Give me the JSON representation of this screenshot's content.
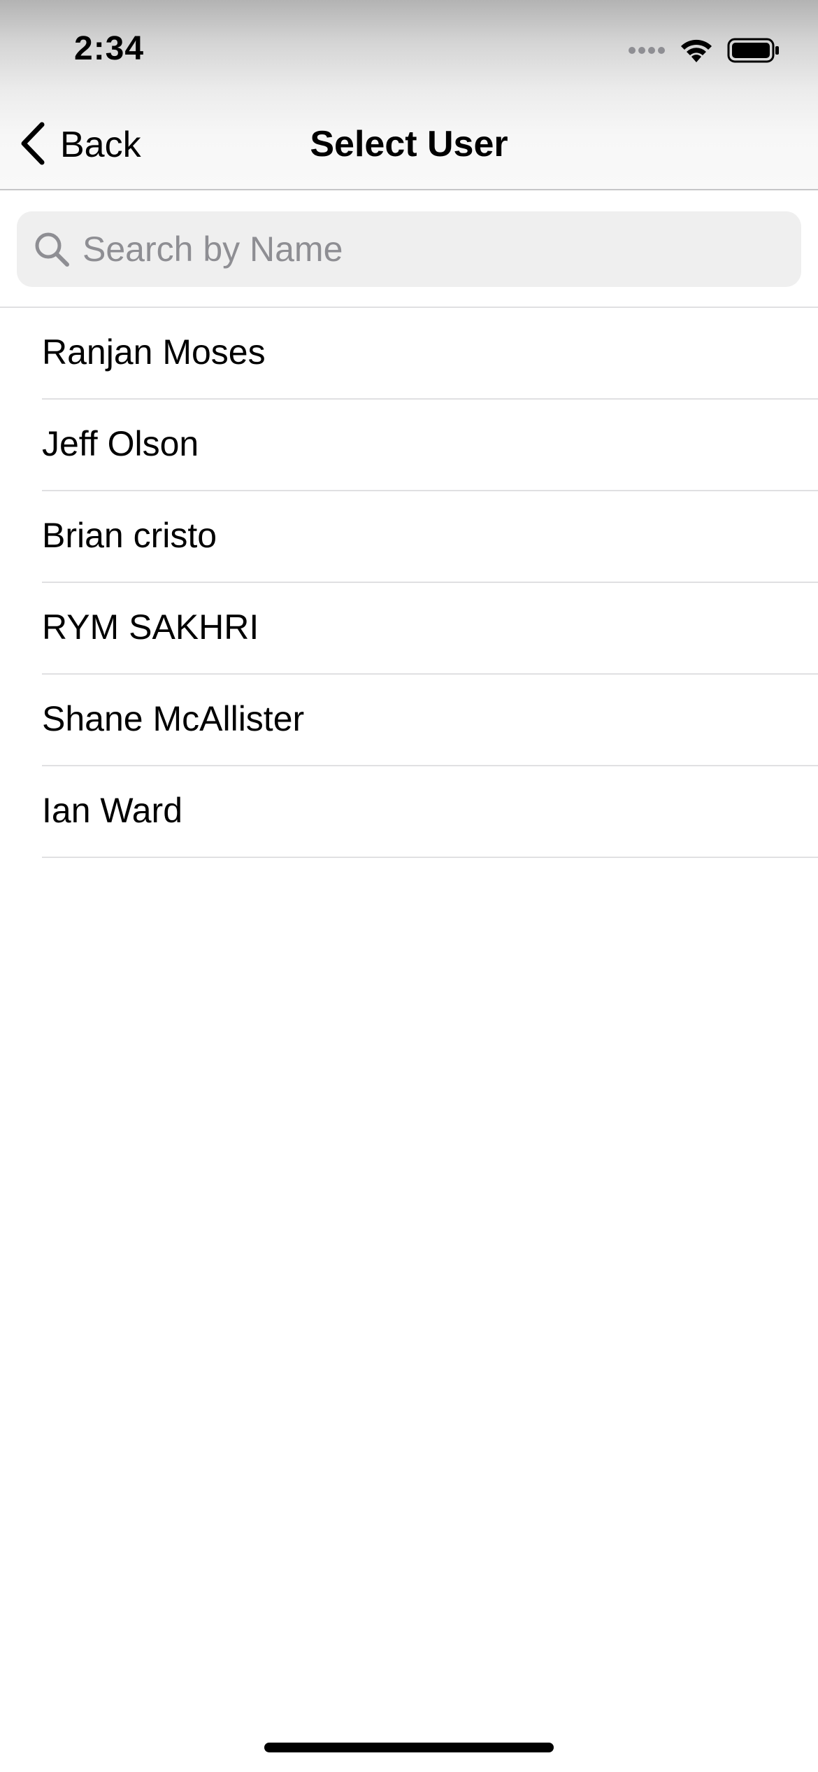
{
  "status_bar": {
    "time": "2:34",
    "icons": [
      "cellular-signal-icon",
      "wifi-icon",
      "battery-icon"
    ]
  },
  "nav": {
    "back_label": "Back",
    "back_icon": "chevron-left-icon",
    "title": "Select User"
  },
  "search": {
    "placeholder": "Search by Name",
    "value": "",
    "icon": "search-icon"
  },
  "users": [
    {
      "name": "Ranjan Moses"
    },
    {
      "name": "Jeff Olson"
    },
    {
      "name": "Brian cristo"
    },
    {
      "name": "RYM SAKHRI"
    },
    {
      "name": "Shane McAllister"
    },
    {
      "name": "Ian Ward"
    }
  ],
  "colors": {
    "separator": "#e0e0e2",
    "search_background": "#efefef",
    "placeholder": "#8e8e93",
    "text": "#000000"
  }
}
